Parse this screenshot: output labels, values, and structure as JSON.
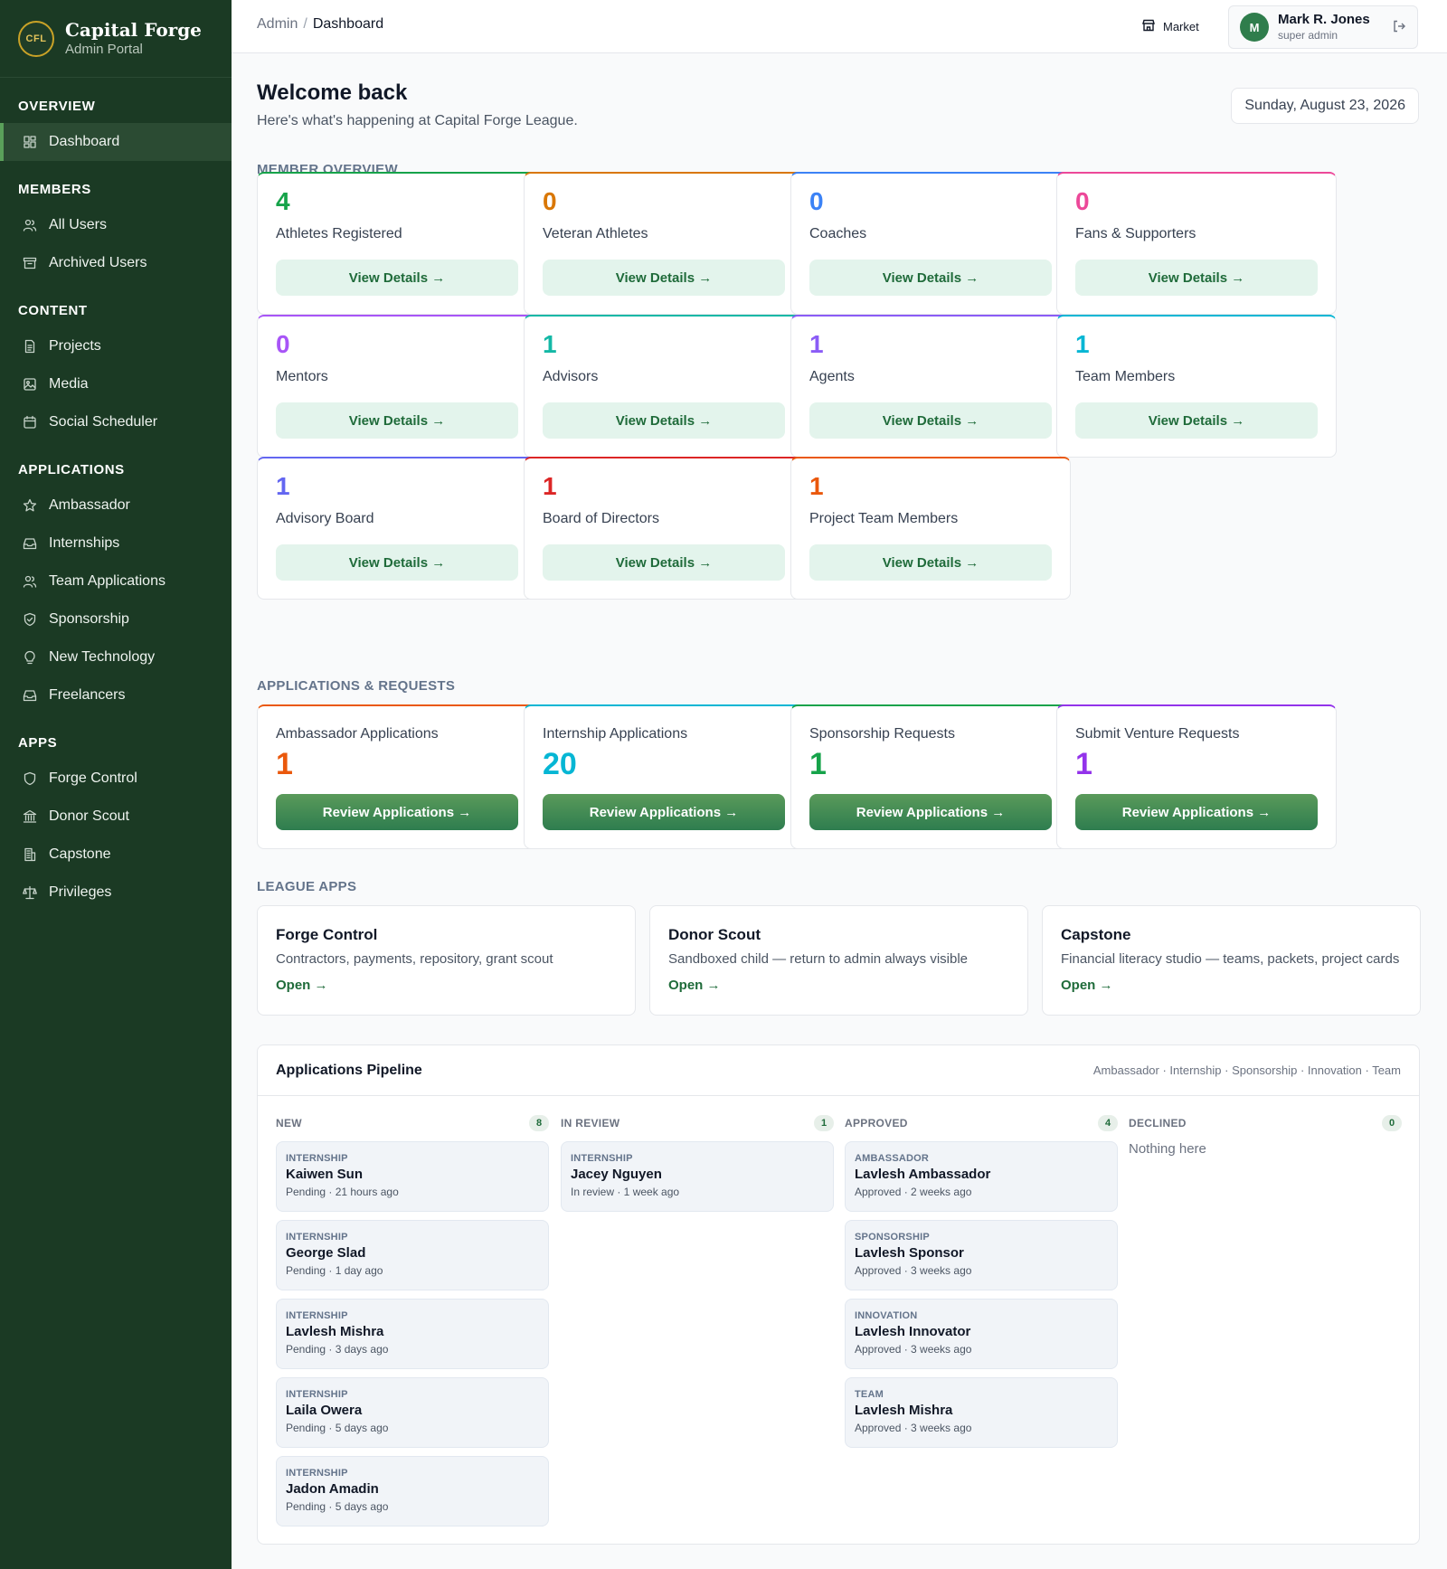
{
  "brand": {
    "logo_text": "CFL",
    "title": "Capital Forge",
    "subtitle": "Admin Portal"
  },
  "sidebar": {
    "sections": [
      {
        "title": "OVERVIEW",
        "items": [
          {
            "label": "Dashboard",
            "icon": "dashboard-icon",
            "active": true
          }
        ]
      },
      {
        "title": "MEMBERS",
        "items": [
          {
            "label": "All Users",
            "icon": "users-icon"
          },
          {
            "label": "Archived Users",
            "icon": "archive-icon"
          }
        ]
      },
      {
        "title": "CONTENT",
        "items": [
          {
            "label": "Projects",
            "icon": "document-icon"
          },
          {
            "label": "Media",
            "icon": "image-icon"
          },
          {
            "label": "Social Scheduler",
            "icon": "calendar-icon"
          }
        ]
      },
      {
        "title": "APPLICATIONS",
        "items": [
          {
            "label": "Ambassador",
            "icon": "star-icon"
          },
          {
            "label": "Internships",
            "icon": "inbox-icon"
          },
          {
            "label": "Team Applications",
            "icon": "users-icon"
          },
          {
            "label": "Sponsorship",
            "icon": "badge-icon"
          },
          {
            "label": "New Technology",
            "icon": "lightbulb-icon"
          },
          {
            "label": "Freelancers",
            "icon": "inbox-icon"
          }
        ]
      },
      {
        "title": "APPS",
        "items": [
          {
            "label": "Forge Control",
            "icon": "shield-icon"
          },
          {
            "label": "Donor Scout",
            "icon": "bank-icon"
          },
          {
            "label": "Capstone",
            "icon": "building-icon"
          },
          {
            "label": "Privileges",
            "icon": "scale-icon"
          }
        ]
      }
    ]
  },
  "topbar": {
    "breadcrumb": [
      "Admin",
      "Dashboard"
    ],
    "market_label": "Market",
    "user": {
      "initial": "M",
      "name": "Mark R. Jones",
      "role": "super admin"
    }
  },
  "welcome": {
    "title": "Welcome back",
    "subtitle": "Here's what's happening at Capital Forge League.",
    "date": "Sunday, August 23, 2026"
  },
  "sections": {
    "members": "MEMBER OVERVIEW",
    "applications": "APPLICATIONS & REQUESTS",
    "league": "LEAGUE APPS"
  },
  "member_cards": [
    {
      "value": "4",
      "label": "Athletes Registered",
      "color": "#16a34a",
      "button": "View Details →"
    },
    {
      "value": "0",
      "label": "Veteran Athletes",
      "color": "#d97706",
      "button": "View Details →"
    },
    {
      "value": "0",
      "label": "Coaches",
      "color": "#3b82f6",
      "button": "View Details →"
    },
    {
      "value": "0",
      "label": "Fans & Supporters",
      "color": "#ec4899",
      "button": "View Details →"
    },
    {
      "value": "0",
      "label": "Mentors",
      "color": "#a855f7",
      "button": "View Details →"
    },
    {
      "value": "1",
      "label": "Advisors",
      "color": "#14b8a6",
      "button": "View Details →"
    },
    {
      "value": "1",
      "label": "Agents",
      "color": "#8b5cf6",
      "button": "View Details →"
    },
    {
      "value": "1",
      "label": "Team Members",
      "color": "#06b6d4",
      "button": "View Details →"
    },
    {
      "value": "1",
      "label": "Advisory Board",
      "color": "#6366f1",
      "button": "View Details →"
    },
    {
      "value": "1",
      "label": "Board of Directors",
      "color": "#dc2626",
      "button": "View Details →"
    },
    {
      "value": "1",
      "label": "Project Team Members",
      "color": "#ea580c",
      "button": "View Details →"
    }
  ],
  "application_cards": [
    {
      "label": "Ambassador Applications",
      "value": "1",
      "color": "#ea580c",
      "button": "Review Applications →"
    },
    {
      "label": "Internship Applications",
      "value": "20",
      "color": "#06b6d4",
      "button": "Review Applications →"
    },
    {
      "label": "Sponsorship Requests",
      "value": "1",
      "color": "#16a34a",
      "button": "Review Applications →"
    },
    {
      "label": "Submit Venture Requests",
      "value": "1",
      "color": "#9333ea",
      "button": "Review Applications →"
    }
  ],
  "league_apps": [
    {
      "title": "Forge Control",
      "desc": "Contractors, payments, repository, grant scout",
      "link": "Open →"
    },
    {
      "title": "Donor Scout",
      "desc": "Sandboxed child — return to admin always visible",
      "link": "Open →"
    },
    {
      "title": "Capstone",
      "desc": "Financial literacy studio — teams, packets, project cards",
      "link": "Open →"
    }
  ],
  "pipeline": {
    "title": "Applications Pipeline",
    "types": "Ambassador · Internship · Sponsorship · Innovation · Team",
    "empty_text": "Nothing here",
    "columns": [
      {
        "name": "NEW",
        "count": "8",
        "cards": [
          {
            "type": "INTERNSHIP",
            "name": "Kaiwen Sun",
            "status": "Pending · 21 hours ago"
          },
          {
            "type": "INTERNSHIP",
            "name": "George Slad",
            "status": "Pending · 1 day ago"
          },
          {
            "type": "INTERNSHIP",
            "name": "Lavlesh Mishra",
            "status": "Pending · 3 days ago"
          },
          {
            "type": "INTERNSHIP",
            "name": "Laila Owera",
            "status": "Pending · 5 days ago"
          },
          {
            "type": "INTERNSHIP",
            "name": "Jadon Amadin",
            "status": "Pending · 5 days ago"
          }
        ]
      },
      {
        "name": "IN REVIEW",
        "count": "1",
        "cards": [
          {
            "type": "INTERNSHIP",
            "name": "Jacey Nguyen",
            "status": "In review · 1 week ago"
          }
        ]
      },
      {
        "name": "APPROVED",
        "count": "4",
        "cards": [
          {
            "type": "AMBASSADOR",
            "name": "Lavlesh Ambassador",
            "status": "Approved · 2 weeks ago"
          },
          {
            "type": "SPONSORSHIP",
            "name": "Lavlesh Sponsor",
            "status": "Approved · 3 weeks ago"
          },
          {
            "type": "INNOVATION",
            "name": "Lavlesh Innovator",
            "status": "Approved · 3 weeks ago"
          },
          {
            "type": "TEAM",
            "name": "Lavlesh Mishra",
            "status": "Approved · 3 weeks ago"
          }
        ]
      },
      {
        "name": "DECLINED",
        "count": "0",
        "cards": []
      }
    ]
  }
}
